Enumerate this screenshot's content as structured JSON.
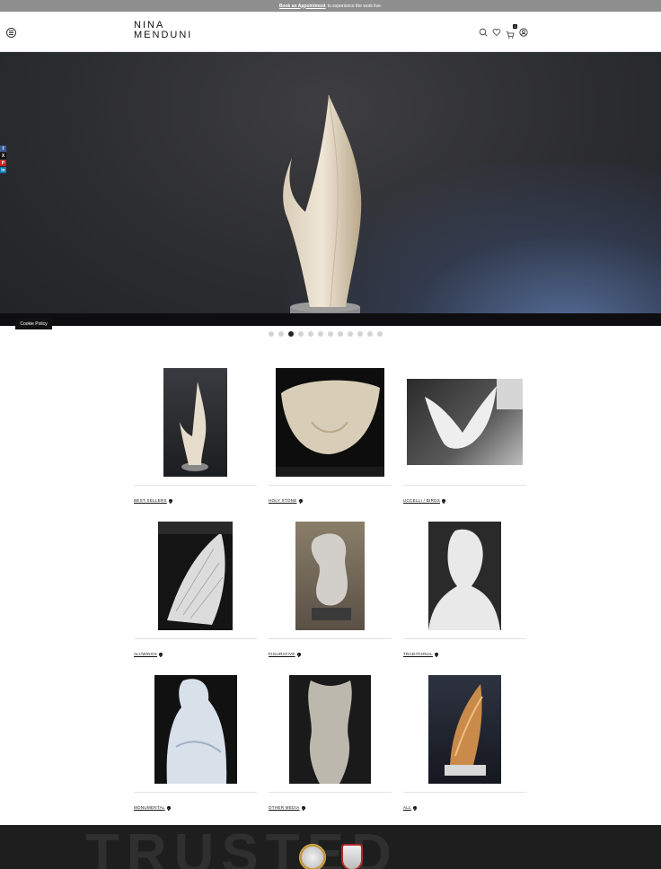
{
  "announcement": {
    "link": "Book an Appointment",
    "text": "to experience the work live."
  },
  "header": {
    "logo_line1": "NINA",
    "logo_line2": "MENDUNI",
    "cart_count": "0",
    "icons": [
      "menu-icon",
      "search-icon",
      "heart-icon",
      "cart-icon",
      "account-icon"
    ]
  },
  "social": [
    "f",
    "X",
    "P",
    "in"
  ],
  "cookie": "Cookie Policy",
  "slider": {
    "count": 12,
    "active": 3
  },
  "categories": [
    {
      "label": "BEST SELLERS"
    },
    {
      "label": "HOLY STONE"
    },
    {
      "label": "UCCELLI / BIRDS"
    },
    {
      "label": "ALI/WINGS"
    },
    {
      "label": "FIGURATIVE"
    },
    {
      "label": "TRADITIONAL"
    },
    {
      "label": "MONUMENTAL"
    },
    {
      "label": "OTHER MEDIA"
    },
    {
      "label": "ALL"
    }
  ],
  "footer": {
    "heading": "TRUSTED"
  },
  "colors": {
    "topbar": "#8e8e8e",
    "footer": "#1e1e1e",
    "text": "#111111"
  }
}
